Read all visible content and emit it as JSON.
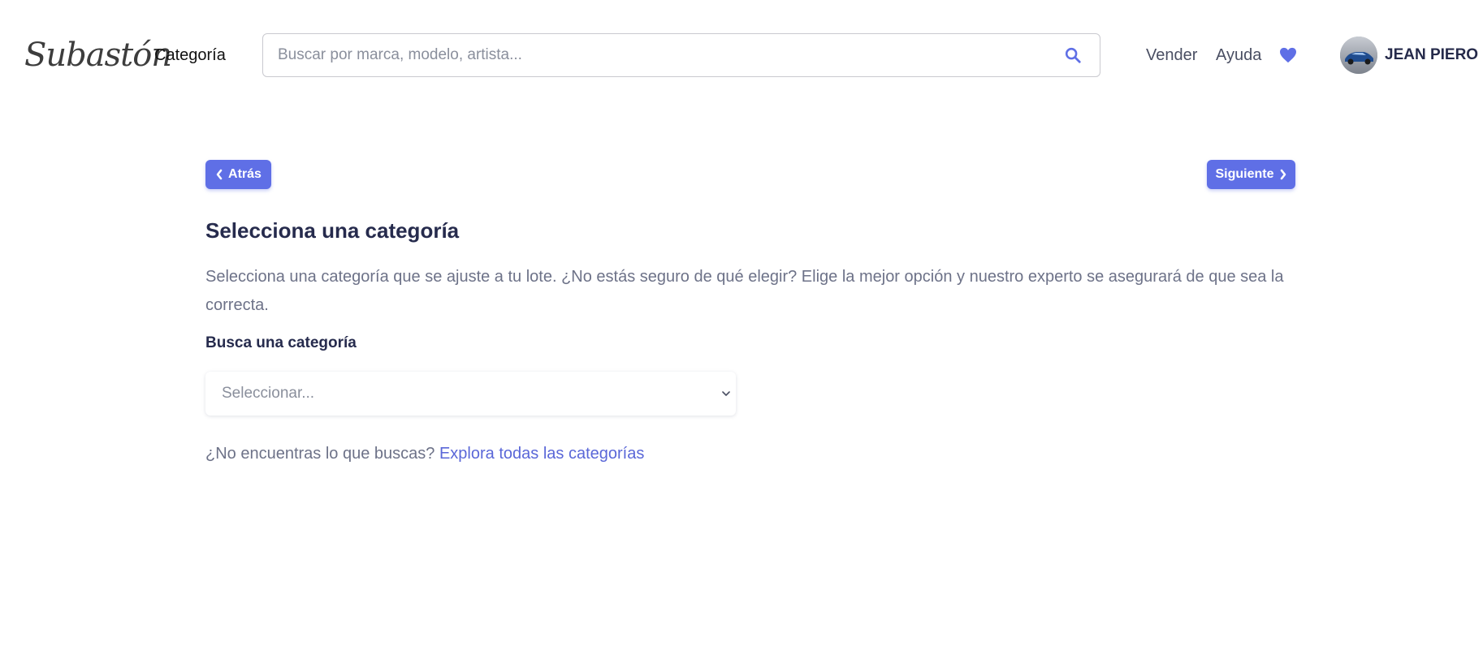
{
  "header": {
    "logo_text": "Subastón",
    "category_label": "Categoría",
    "search": {
      "placeholder": "Buscar por marca, modelo, artista...",
      "value": "",
      "icon": "search-icon"
    },
    "links": {
      "sell": "Vender",
      "help": "Ayuda"
    },
    "favorites_icon": "heart-icon",
    "user": {
      "name": "JEAN PIERO",
      "avatar_icon": "car-avatar"
    }
  },
  "main": {
    "back_button": "Atrás",
    "next_button": "Siguiente",
    "title": "Selecciona una categoría",
    "description": "Selecciona una categoría que se ajuste a tu lote. ¿No estás seguro de qué elegir? Elige la mejor opción y nuestro experto se asegurará de que sea la correcta.",
    "search_label": "Busca una categoría",
    "select_placeholder": "Seleccionar...",
    "not_found_text": "¿No encuentras lo que buscas?",
    "explore_link": "Explora todas las categorías"
  },
  "colors": {
    "accent": "#5f6fe6",
    "link": "#5a67d8",
    "title": "#262b4d",
    "body_text": "#6d7288"
  }
}
